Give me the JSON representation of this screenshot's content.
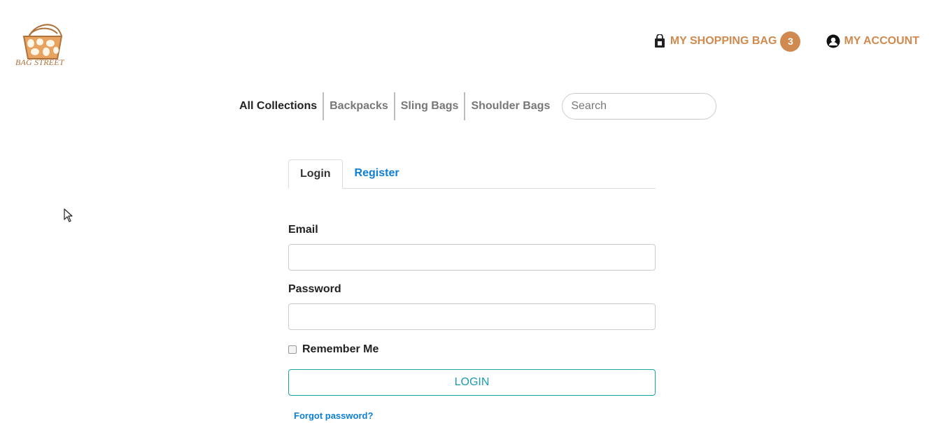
{
  "brand": {
    "name": "BAG STREET"
  },
  "header": {
    "shopping_bag_label": "MY SHOPPING BAG",
    "bag_count": "3",
    "account_label": "MY ACCOUNT"
  },
  "nav": {
    "items": [
      "All Collections",
      "Backpacks",
      "Sling Bags",
      "Shoulder Bags"
    ],
    "search_placeholder": "Search"
  },
  "auth": {
    "tabs": [
      "Login",
      "Register"
    ],
    "email_label": "Email",
    "password_label": "Password",
    "remember_label": "Remember Me",
    "login_button": "LOGIN",
    "forgot_link": "Forgot password?"
  },
  "colors": {
    "accent": "#d08a4f",
    "link": "#0d7fd8",
    "button_border": "#1aa6a6"
  },
  "icons": [
    "bag-logo-icon",
    "shopping-bag-icon",
    "user-account-icon",
    "mouse-cursor-icon"
  ]
}
